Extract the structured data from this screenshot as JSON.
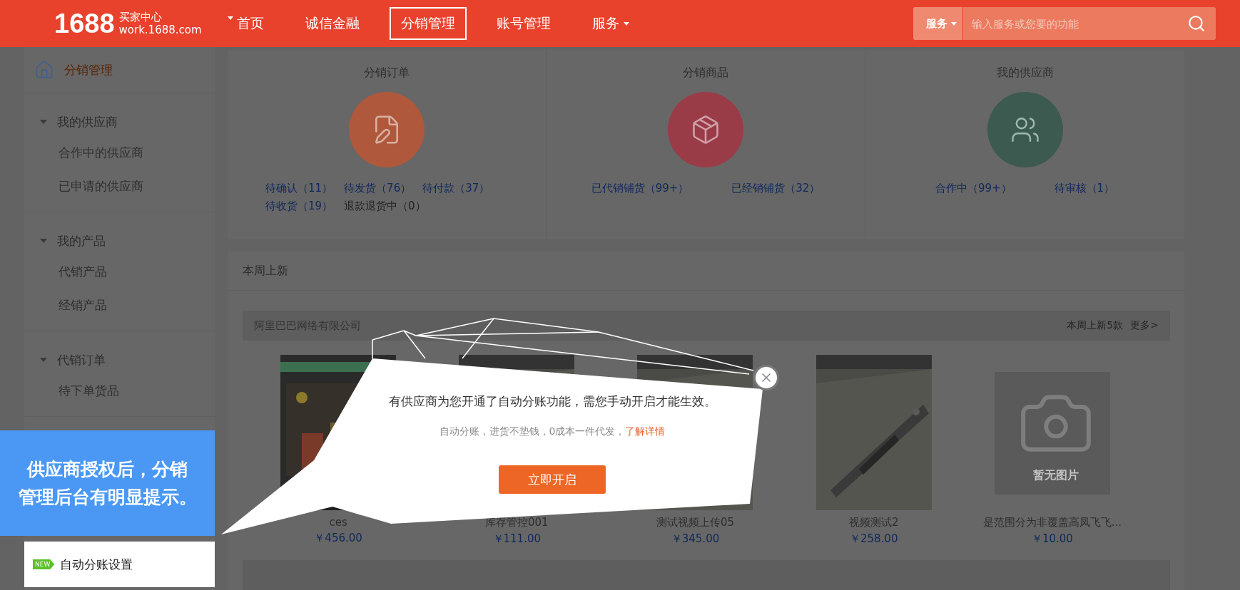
{
  "topbar": {
    "logo": {
      "number": "1688",
      "title": "买家中心",
      "domain": "work.1688.com"
    },
    "nav": [
      {
        "label": "首页",
        "selected": false,
        "has_menu": false
      },
      {
        "label": "诚信金融",
        "selected": false,
        "has_menu": false
      },
      {
        "label": "分销管理",
        "selected": true,
        "has_menu": false
      },
      {
        "label": "账号管理",
        "selected": false,
        "has_menu": false
      },
      {
        "label": "服务",
        "selected": false,
        "has_menu": true
      }
    ],
    "search": {
      "scope": "服务",
      "placeholder": "输入服务或您要的功能"
    }
  },
  "sidebar": {
    "title": "分销管理",
    "groups": [
      {
        "label": "我的供应商",
        "expanded": true,
        "items": [
          "合作中的供应商",
          "已申请的供应商"
        ]
      },
      {
        "label": "我的产品",
        "expanded": true,
        "items": [
          "代销产品",
          "经销产品"
        ]
      },
      {
        "label": "代销订单",
        "expanded": true,
        "items": [
          "待下单货品"
        ]
      }
    ],
    "highlighted_item": {
      "badge": "NEW",
      "label": "自动分账设置"
    }
  },
  "summary_cards": [
    {
      "title": "分销订单",
      "color": "#b0583c",
      "stats": [
        {
          "text": "待确认（11）",
          "kind": "link"
        },
        {
          "text": "待发货（76）",
          "kind": "link"
        },
        {
          "text": "待付款（37）",
          "kind": "link"
        },
        {
          "text": "待收货（19）",
          "kind": "link"
        },
        {
          "text": "退款退货中（0）",
          "kind": "text"
        }
      ]
    },
    {
      "title": "分销商品",
      "color": "#9a3c47",
      "stats": [
        {
          "text": "已代销铺货（99+）",
          "kind": "link"
        },
        {
          "text": "已经销铺货（32）",
          "kind": "link"
        }
      ]
    },
    {
      "title": "我的供应商",
      "color": "#3c5a50",
      "stats": [
        {
          "text": "合作中（99+）",
          "kind": "link"
        },
        {
          "text": "待审核（1）",
          "kind": "link"
        }
      ]
    }
  ],
  "new_this_week": {
    "title": "本周上新",
    "suppliers": [
      {
        "name": "阿里巴巴网络有限公司",
        "count": "本周上新5款",
        "more": "更多>",
        "products": [
          {
            "kind": "screen",
            "name": "ces",
            "price": "￥456.00"
          },
          {
            "name": "库存管控001",
            "price": "￥111.00"
          },
          {
            "name": "测试视频上传05",
            "price": "￥345.00"
          },
          {
            "name": "视频测试2",
            "price": "￥258.00"
          },
          {
            "kind": "placeholder",
            "name": "是范围分为非覆盖高凤飞飞...",
            "price": "￥10.00",
            "placeholder_text": "暂无图片"
          }
        ]
      }
    ]
  },
  "popup": {
    "message": "有供应商为您开通了自动分账功能，需您手动开启才能生效。",
    "subtext": "自动分账，进货不垫钱，0成本一件代发，",
    "link": "了解详情",
    "button": "立即开启"
  },
  "callout": {
    "lines": [
      "供应商授权后，分销",
      "管理后台有明显提示。"
    ]
  }
}
